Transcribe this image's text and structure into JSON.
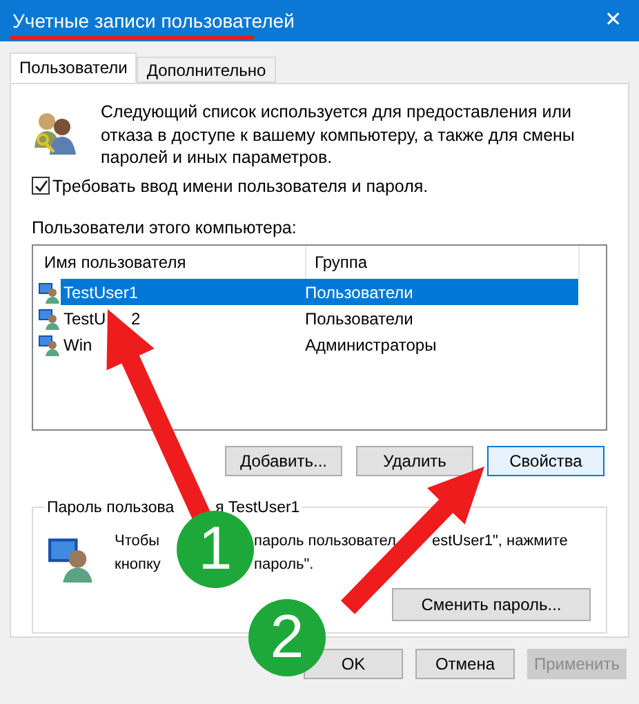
{
  "window": {
    "title": "Учетные записи пользователей",
    "close": "✕"
  },
  "tabs": [
    {
      "label": "Пользователи",
      "selected": true
    },
    {
      "label": "Дополнительно",
      "selected": false
    }
  ],
  "description": "Следующий список используется для предоставления или отказа в доступе к вашему компьютеру, а также для смены паролей и иных параметров.",
  "require_login": {
    "label": "Требовать ввод имени пользователя и пароля.",
    "checked": true
  },
  "users_caption": "Пользователи этого компьютера:",
  "table": {
    "columns": [
      "Имя пользователя",
      "Группа"
    ],
    "rows": [
      {
        "name_parts": [
          "TestUser1"
        ],
        "group": "Пользователи",
        "selected": true
      },
      {
        "name_parts": [
          "TestU",
          "2"
        ],
        "group": "Пользователи",
        "selected": false
      },
      {
        "name_parts": [
          "Win"
        ],
        "group": "Администраторы",
        "selected": false
      }
    ]
  },
  "table_buttons": [
    {
      "label": "Добавить...",
      "focused": false
    },
    {
      "label": "Удалить",
      "focused": false
    },
    {
      "label": "Свойства",
      "focused": true
    }
  ],
  "password_group": {
    "caption_parts": [
      "Пароль пользова",
      "я TestUser1"
    ],
    "text_lines": [
      [
        "Чтобы",
        "пароль пользовател",
        "estUser1\", нажмите"
      ],
      [
        "кнопку",
        "пароль\"."
      ]
    ],
    "button": "Сменить пароль..."
  },
  "footer_buttons": [
    {
      "label": "OK",
      "disabled": false
    },
    {
      "label": "Отмена",
      "disabled": false
    },
    {
      "label": "Применить",
      "disabled": true
    }
  ],
  "annotations": [
    {
      "kind": "arrow"
    },
    {
      "kind": "arrow"
    },
    {
      "kind": "badge",
      "label": "1"
    },
    {
      "kind": "badge",
      "label": "2"
    },
    {
      "kind": "underline"
    }
  ]
}
